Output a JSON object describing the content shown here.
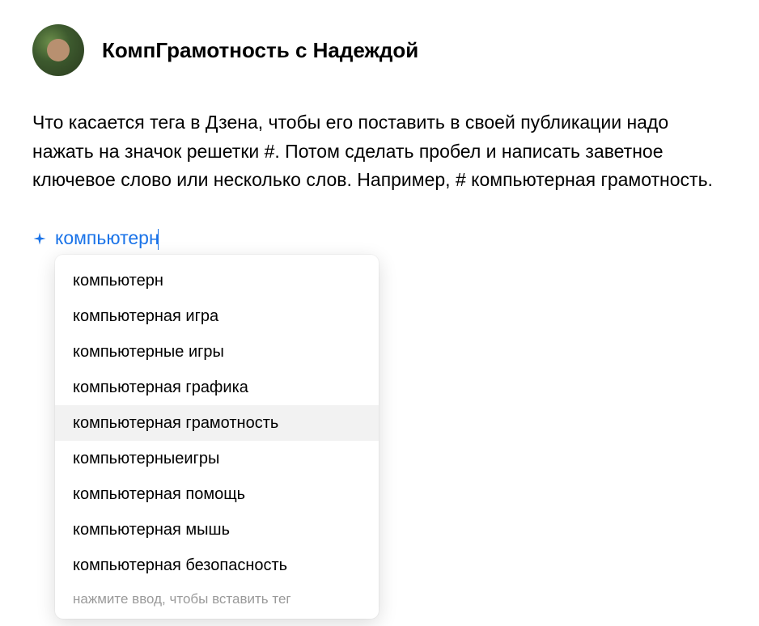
{
  "author": {
    "name": "КомпГрамотность с Надеждой"
  },
  "body": "Что касается тега в Дзена, чтобы его поставить в своей публикации надо нажать на значок решетки #. Потом сделать пробел и написать заветное ключевое слово или несколько слов. Например,  # компьютерная грамотность.",
  "tag_input": {
    "value": "компьютерн"
  },
  "suggestions": {
    "items": [
      "компьютерн",
      "компьютерная игра",
      "компьютерные игры",
      "компьютерная графика",
      "компьютерная грамотность",
      "компьютерныеигры",
      "компьютерная помощь",
      "компьютерная мышь",
      "компьютерная безопасность"
    ],
    "highlighted_index": 4,
    "hint": "нажмите ввод, чтобы вставить тег"
  }
}
